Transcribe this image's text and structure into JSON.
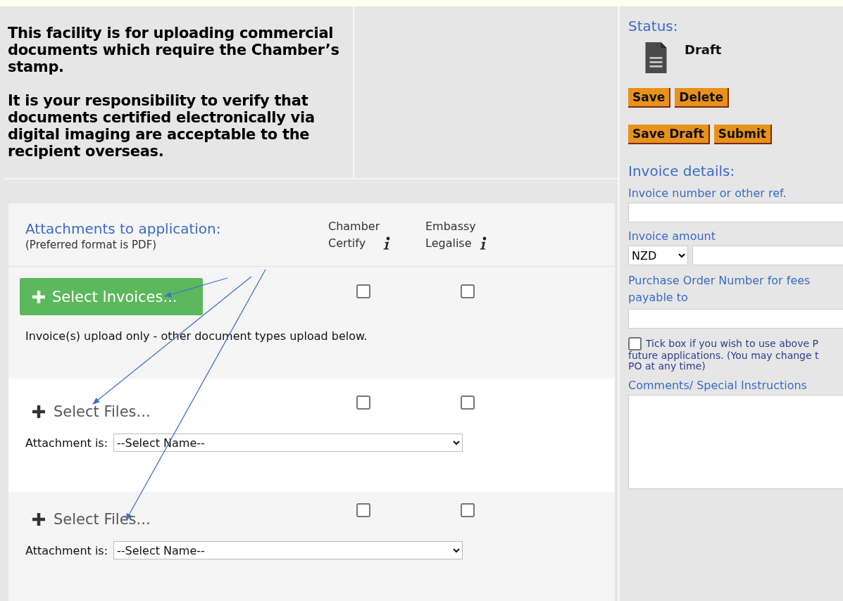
{
  "notice": {
    "paragraphs": [
      "This facility is for uploading commercial documents which require the Chamber’s stamp.",
      "It is your responsibility to verify that documents certified electronically via digital imaging are acceptable to the recipient overseas."
    ]
  },
  "attachments": {
    "title": "Attachments to application:",
    "subtitle": "(Preferred format is PDF)",
    "columns": [
      {
        "label": "Chamber Certify"
      },
      {
        "label": "Embassy Legalise"
      }
    ],
    "rows": [
      {
        "kind": "invoice",
        "button": "Select Invoices...",
        "note": "Invoice(s) upload only - other document types upload below.",
        "checks": [
          false,
          false
        ]
      },
      {
        "kind": "file",
        "button": "Select Files...",
        "attachment_label": "Attachment is:",
        "attachment_value": "--Select Name--",
        "checks": [
          false,
          false
        ]
      },
      {
        "kind": "file",
        "button": "Select Files...",
        "attachment_label": "Attachment is:",
        "attachment_value": "--Select Name--",
        "checks": [
          false,
          false
        ]
      }
    ]
  },
  "status": {
    "label": "Status:",
    "value": "Draft",
    "button_rows": [
      [
        "Save",
        "Delete"
      ],
      [
        "Save Draft",
        "Submit"
      ]
    ]
  },
  "invoice_details": {
    "title": "Invoice details:",
    "number_label": "Invoice number or other ref.",
    "amount_label": "Invoice amount",
    "currency": "NZD",
    "po_label": "Purchase Order Number for fees payable to",
    "tick": {
      "checked": false,
      "lines": [
        "Tick box if you wish to use above P",
        "future applications. (You may change t",
        "PO at any time)"
      ]
    },
    "comments_label": "Comments/ Special Instructions"
  }
}
